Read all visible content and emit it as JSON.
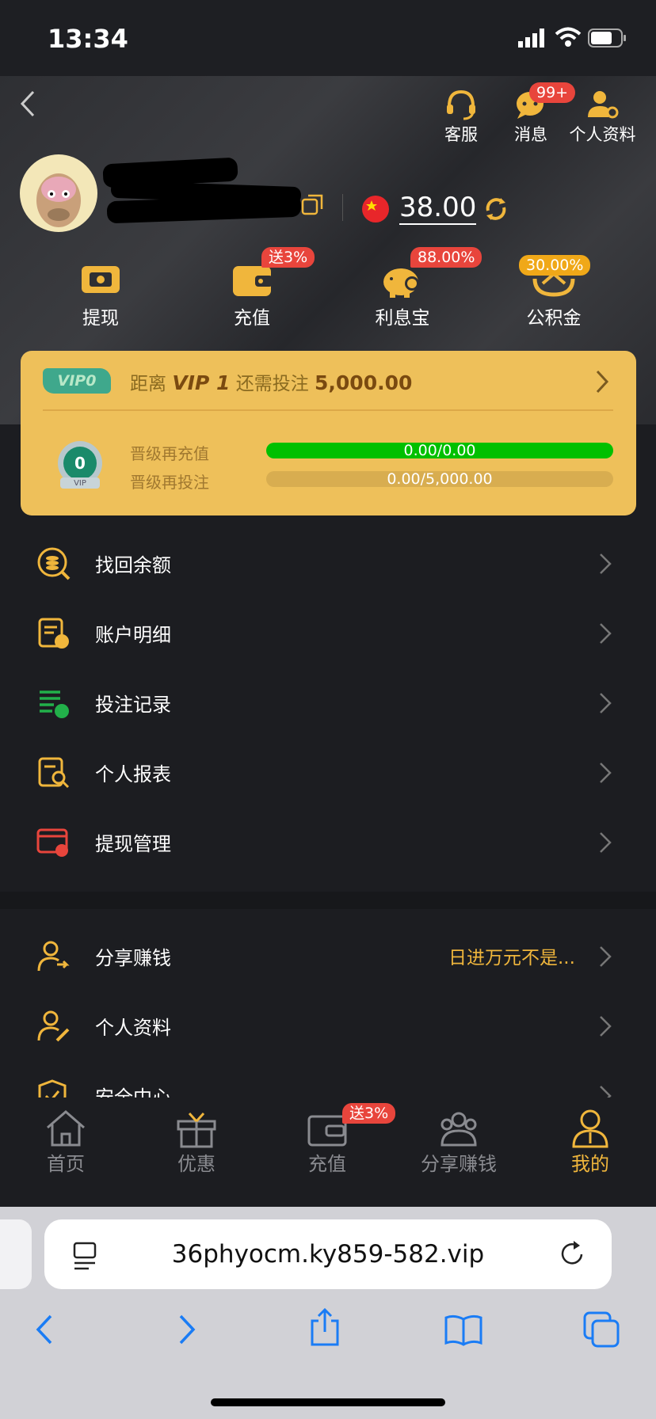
{
  "status": {
    "time": "13:34"
  },
  "top": {
    "service": "客服",
    "messages": "消息",
    "messages_badge": "99+",
    "profile": "个人资料"
  },
  "account": {
    "balance": "38.00"
  },
  "quick": [
    {
      "label": "提现",
      "badge": ""
    },
    {
      "label": "充值",
      "badge": "送3%"
    },
    {
      "label": "利息宝",
      "badge": "88.00%"
    },
    {
      "label": "公积金",
      "badge": "30.00%"
    }
  ],
  "vip": {
    "level_badge": "VIP0",
    "text_prefix": "距离",
    "next_level": "VIP 1",
    "text_mid": "还需投注",
    "amount": "5,000.00",
    "medal_number": "0",
    "medal_label": "VIP",
    "rows": [
      {
        "label": "晋级再充值",
        "progress": "0.00/0.00",
        "fill": 1.0
      },
      {
        "label": "晋级再投注",
        "progress": "0.00/5,000.00",
        "fill": 0.0
      }
    ]
  },
  "menu1": [
    {
      "label": "找回余额",
      "icon": "recover-balance-icon"
    },
    {
      "label": "账户明细",
      "icon": "account-details-icon"
    },
    {
      "label": "投注记录",
      "icon": "bet-records-icon"
    },
    {
      "label": "个人报表",
      "icon": "personal-report-icon"
    },
    {
      "label": "提现管理",
      "icon": "withdraw-manage-icon"
    }
  ],
  "menu2": [
    {
      "label": "分享赚钱",
      "hint": "日进万元不是..."
    },
    {
      "label": "个人资料",
      "hint": ""
    },
    {
      "label": "安全中心",
      "hint": ""
    }
  ],
  "tabs": [
    {
      "label": "首页",
      "active": false,
      "badge": ""
    },
    {
      "label": "优惠",
      "active": false,
      "badge": ""
    },
    {
      "label": "充值",
      "active": false,
      "badge": "送3%"
    },
    {
      "label": "分享赚钱",
      "active": false,
      "badge": ""
    },
    {
      "label": "我的",
      "active": true,
      "badge": ""
    }
  ],
  "browser": {
    "url": "36phyocm.ky859-582.vip"
  },
  "colors": {
    "accent": "#f0b63c",
    "bg": "#1c1d21",
    "badge": "#e8453c",
    "green": "#00c000"
  }
}
